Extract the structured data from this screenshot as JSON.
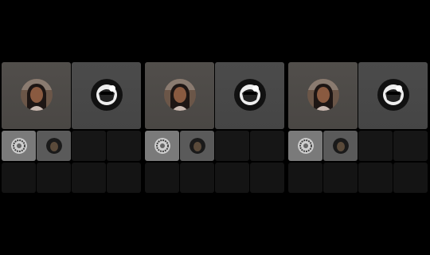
{
  "panels": [
    {
      "id": "panel-1",
      "tiles": [
        "photo-avatar-woman",
        "photo-avatar-mono",
        "thumb-pattern",
        "thumb-dark",
        "empty",
        "empty",
        "empty",
        "empty",
        "empty",
        "empty"
      ]
    },
    {
      "id": "panel-2",
      "tiles": [
        "photo-avatar-woman",
        "photo-avatar-mono",
        "thumb-pattern",
        "thumb-dark",
        "empty",
        "empty",
        "empty",
        "empty",
        "empty",
        "empty"
      ]
    },
    {
      "id": "panel-3",
      "tiles": [
        "photo-avatar-woman",
        "photo-avatar-mono",
        "thumb-pattern",
        "thumb-dark",
        "empty",
        "empty",
        "empty",
        "empty",
        "empty",
        "empty"
      ]
    }
  ]
}
